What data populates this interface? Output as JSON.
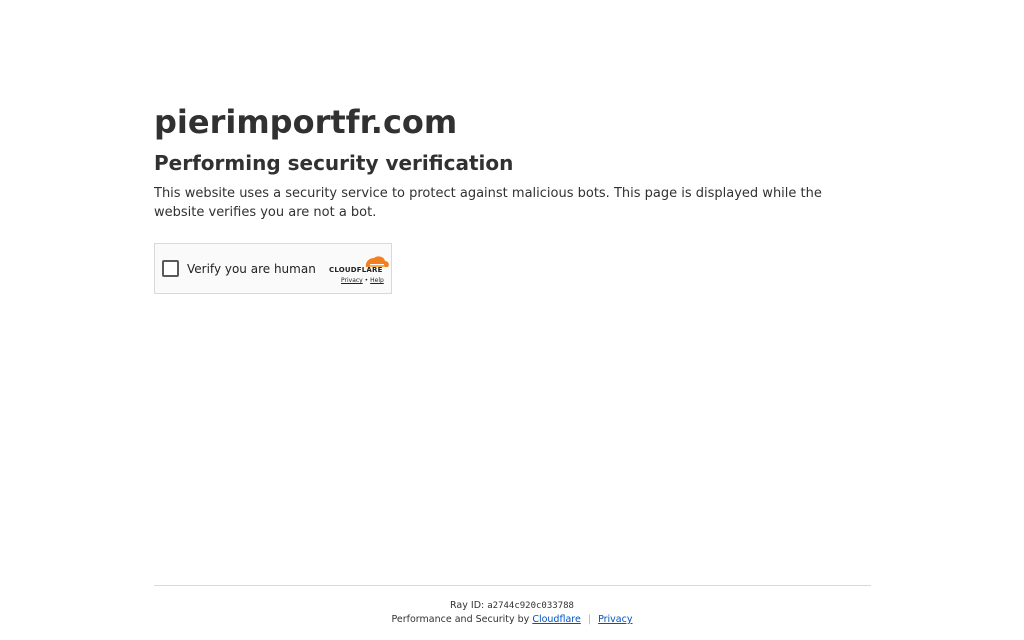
{
  "page": {
    "site_title": "pierimportfr.com",
    "heading": "Performing security verification",
    "description": "This website uses a security service to protect against malicious bots. This page is displayed while the website verifies you are not a bot."
  },
  "widget": {
    "verify_label": "Verify you are human",
    "brand": "CLOUDFLARE",
    "privacy_link": "Privacy",
    "link_separator": "•",
    "help_link": "Help",
    "logo_icon": "cloud-icon",
    "brand_color": "#f38020"
  },
  "footer": {
    "ray_id_label": "Ray ID:",
    "ray_id": "a2744c920c033788",
    "performance_text": "Performance and Security by",
    "cloudflare_link": "Cloudflare",
    "separator": "|",
    "privacy_link": "Privacy",
    "link_color": "#0051c3"
  }
}
